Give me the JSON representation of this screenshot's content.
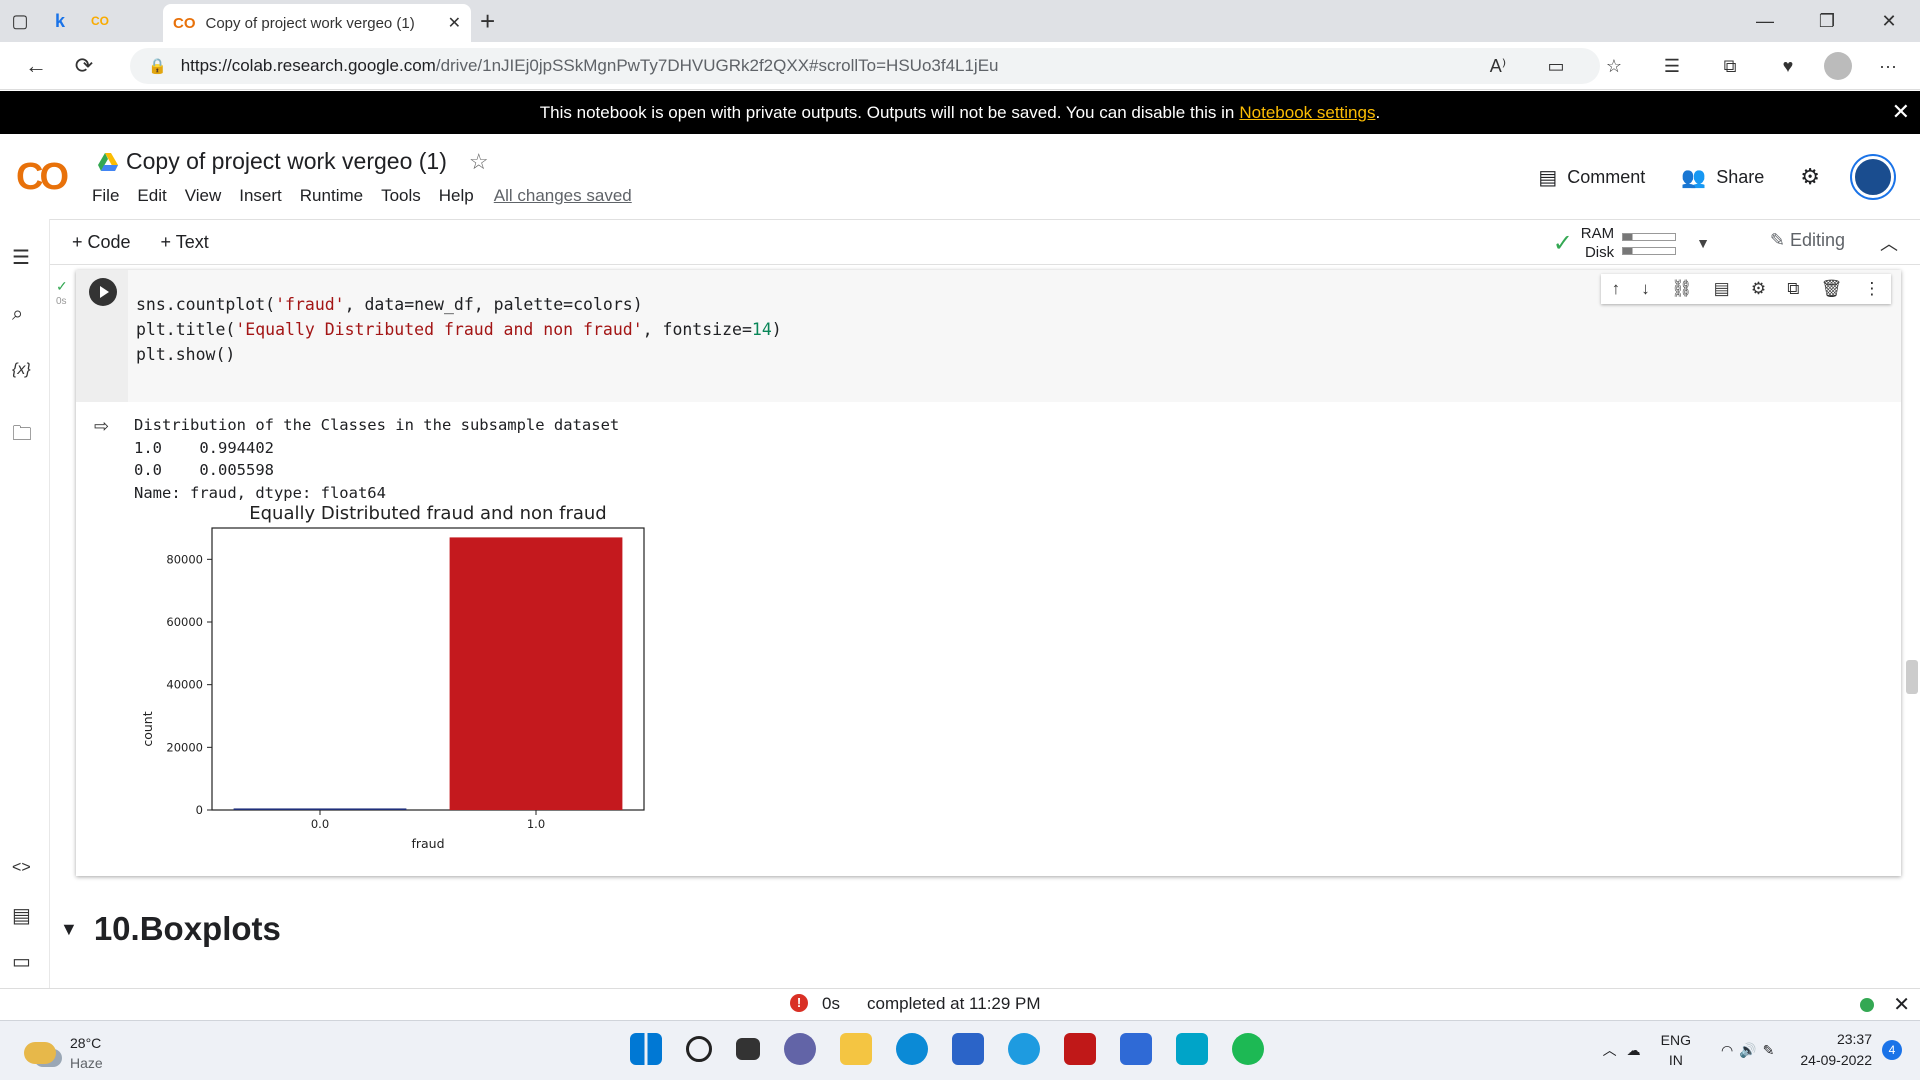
{
  "browser": {
    "tab_title": "Copy of project work vergeo (1)",
    "tab_logo": "CO",
    "url_host": "https://colab.research.google.com",
    "url_path": "/drive/1nJIEj0jpSSkMgnPwTy7DHVUGRk2f2QXX#scrollTo=HSUo3f4L1jEu"
  },
  "banner": {
    "text": "This notebook is open with private outputs. Outputs will not be saved. You can disable this in",
    "link": "Notebook settings",
    "suffix": "."
  },
  "header": {
    "logo": "CO",
    "notebook_title": "Copy of project work vergeo (1)",
    "menu": [
      "File",
      "Edit",
      "View",
      "Insert",
      "Runtime",
      "Tools",
      "Help"
    ],
    "save_status": "All changes saved",
    "comment_label": "Comment",
    "share_label": "Share"
  },
  "toolbar": {
    "add_code": "+ Code",
    "add_text": "+ Text",
    "ram_label": "RAM",
    "disk_label": "Disk",
    "mode": "Editing"
  },
  "cell": {
    "exec_time": "0s",
    "code_lines": [
      "sns.countplot('fraud', data=new_df, palette=colors)",
      "plt.title('Equally Distributed fraud and non fraud', fontsize=14)",
      "plt.show()"
    ],
    "output_lines": [
      "Distribution of the Classes in the subsample dataset",
      "1.0    0.994402",
      "0.0    0.005598",
      "Name: fraud, dtype: float64"
    ]
  },
  "chart_data": {
    "type": "bar",
    "title": "Equally Distributed fraud and non fraud",
    "xlabel": "fraud",
    "ylabel": "count",
    "categories": [
      "0.0",
      "1.0"
    ],
    "values": [
      500,
      87000
    ],
    "colors": [
      "#1f2f7a",
      "#c4191e"
    ],
    "ylim": [
      0,
      90000
    ],
    "yticks": [
      0,
      20000,
      40000,
      60000,
      80000
    ]
  },
  "section": {
    "heading": "10.Boxplots"
  },
  "status": {
    "exec_time": "0s",
    "message": "completed at 11:29 PM"
  },
  "taskbar": {
    "temp": "28°C",
    "weather": "Haze",
    "lang1": "ENG",
    "lang2": "IN",
    "time": "23:37",
    "date": "24-09-2022",
    "notif_count": "4"
  }
}
